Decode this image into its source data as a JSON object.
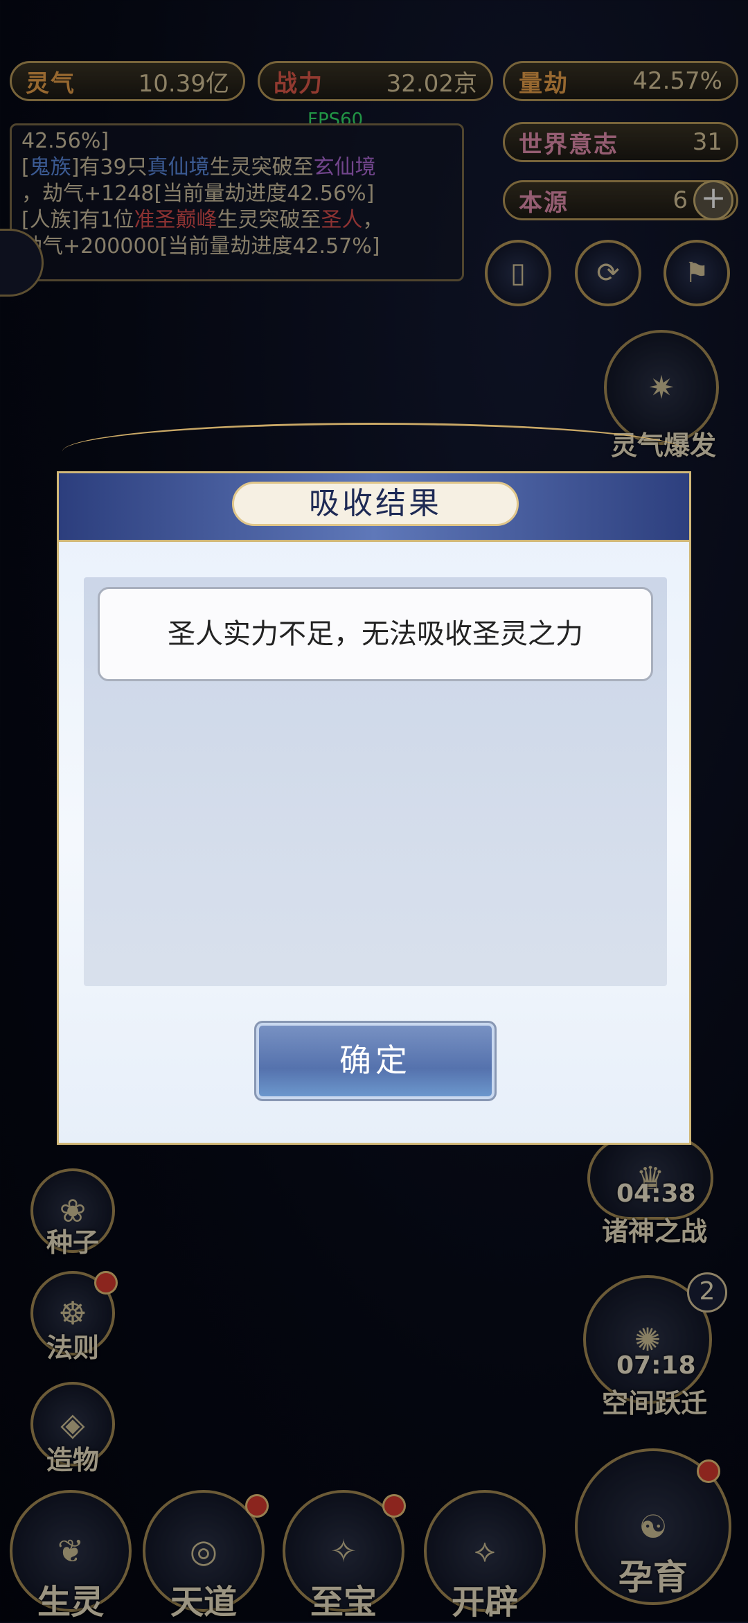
{
  "stats": {
    "lingqi": {
      "label": "灵气",
      "value": "10.39亿"
    },
    "zhanli": {
      "label": "战力",
      "value": "32.02京"
    },
    "liangjie": {
      "label": "量劫",
      "value": "42.57%"
    },
    "world_will": {
      "label": "世界意志",
      "value": "31"
    },
    "origin": {
      "label": "本源",
      "value": "6",
      "plus": "+"
    }
  },
  "fps": "FPS60",
  "log": {
    "line0": "42.56%]",
    "e1_a": "[",
    "e1_race": "鬼族",
    "e1_b": "]有39只",
    "e1_rank": "真仙境",
    "e1_c": "生灵突破至",
    "e1_target": "玄仙境",
    "e1_d": "，劫气+1248[当前量劫进度42.56%]",
    "e2_a": "[人族]有1位",
    "e2_rank": "准圣巅峰",
    "e2_c": "生灵突破至",
    "e2_target": "圣人",
    "e2_comma": "，",
    "e2_d": "劫气+200000[当前量劫进度42.57%]"
  },
  "side_right": {
    "lingqi_burst": "灵气爆发",
    "battle_timer": "04:38",
    "battle_label": "诸神之战",
    "space_badge": "2",
    "space_timer": "07:18",
    "space_label": "空间跃迁",
    "breed_label": "孕育"
  },
  "side_left": {
    "seed": "种子",
    "law": "法则",
    "creation": "造物"
  },
  "bottom_nav": [
    "生灵",
    "天道",
    "至宝",
    "开辟"
  ],
  "modal": {
    "title": "吸收结果",
    "message": "圣人实力不足，无法吸收圣灵之力",
    "ok": "确定"
  }
}
